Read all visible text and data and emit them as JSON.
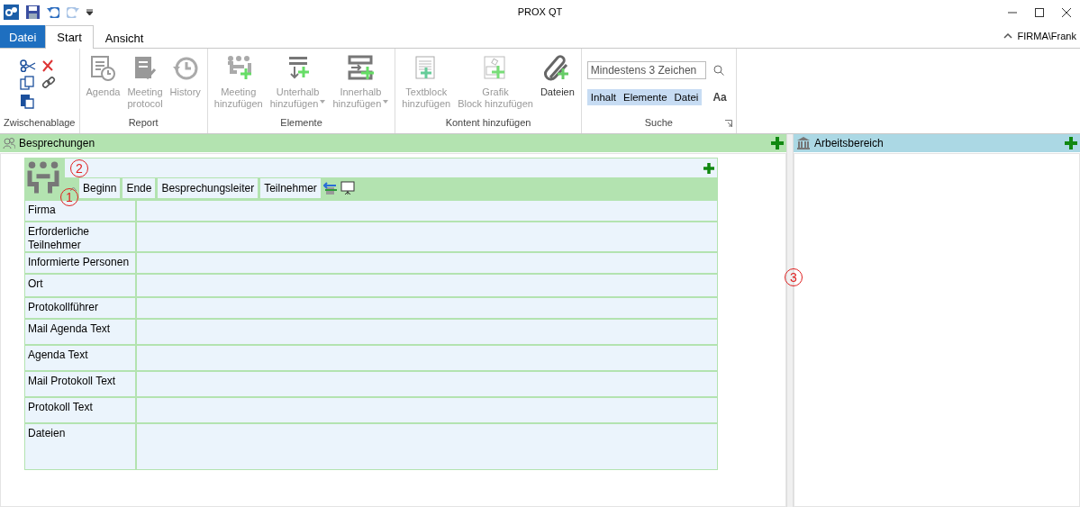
{
  "window": {
    "title": "PROX QT",
    "user": "FIRMA\\Frank"
  },
  "tabs": [
    {
      "label": "Datei",
      "kind": "file",
      "selected": false
    },
    {
      "label": "Start",
      "kind": "tab",
      "selected": true
    },
    {
      "label": "Ansicht",
      "kind": "tab",
      "selected": false
    }
  ],
  "ribbon": {
    "groups": [
      {
        "label": "Zwischenablage",
        "kind": "clipboard"
      },
      {
        "label": "Report",
        "kind": "buttons",
        "buttons": [
          {
            "label": "Agenda",
            "kind": "agenda",
            "disabled": true
          },
          {
            "label": "Meeting protocol",
            "kind": "protocol",
            "disabled": true
          },
          {
            "label": "History",
            "kind": "history",
            "disabled": true
          }
        ]
      },
      {
        "label": "Elemente",
        "kind": "buttons",
        "buttons": [
          {
            "label": "Meeting hinzufügen",
            "kind": "meeting",
            "disabled": true,
            "dropdown": false
          },
          {
            "label": "Unterhalb hinzufügen",
            "kind": "below",
            "disabled": true,
            "dropdown": true
          },
          {
            "label": "Innerhalb hinzufügen",
            "kind": "inside",
            "disabled": true,
            "dropdown": true
          }
        ]
      },
      {
        "label": "Kontent hinzufügen",
        "kind": "buttons",
        "buttons": [
          {
            "label": "Textblock hinzufügen",
            "kind": "textblock",
            "disabled": true
          },
          {
            "label": "Grafik Block hinzufügen",
            "kind": "graphic",
            "disabled": true
          },
          {
            "label": "Dateien",
            "kind": "clip",
            "disabled": false
          }
        ]
      },
      {
        "label": "Suche",
        "kind": "search",
        "placeholder": "Mindestens 3 Zeichen",
        "filters": [
          {
            "label": "Inhalt",
            "selected": true
          },
          {
            "label": "Elemente",
            "selected": true
          },
          {
            "label": "Datei",
            "selected": true
          }
        ],
        "case_label": "Aa"
      }
    ]
  },
  "meetings_panel": {
    "title": "Besprechungen",
    "columns": [
      "Beginn",
      "Ende",
      "Besprechungsleiter",
      "Teilnehmer"
    ],
    "fields": [
      "Firma",
      "Erforderliche Teilnehmer",
      "Informierte Personen",
      "Ort",
      "Protokollführer",
      "Mail Agenda Text",
      "Agenda Text",
      "Mail Protokoll Text",
      "Protokoll Text",
      "Dateien"
    ]
  },
  "workspace_panel": {
    "title": "Arbeitsbereich"
  },
  "callouts": [
    "1",
    "2",
    "3"
  ]
}
